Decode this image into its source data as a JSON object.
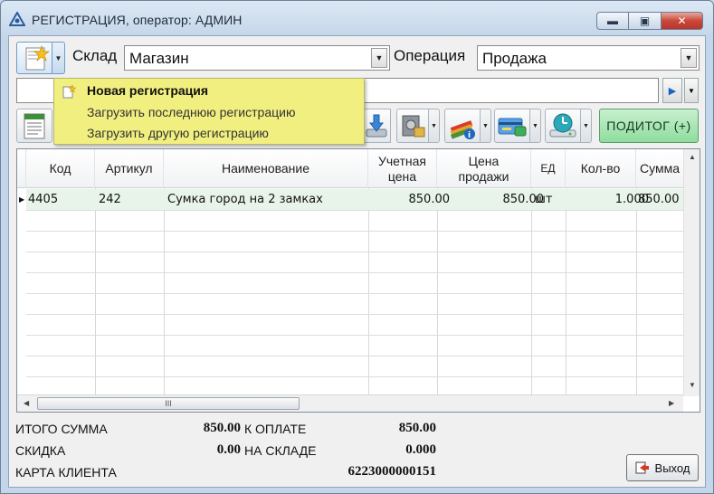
{
  "window": {
    "title": "РЕГИСТРАЦИЯ, оператор: АДМИН",
    "minimize_label": "▬",
    "maximize_label": "▣",
    "close_label": "✕"
  },
  "filters": {
    "warehouse_label": "Склад",
    "warehouse_value": "Магазин",
    "operation_label": "Операция",
    "operation_value": "Продажа"
  },
  "search": {
    "value": "",
    "go_icon": "play-arrow-icon"
  },
  "toolbar": {
    "subtotal_label": "ПОДИТОГ (+)",
    "icons": [
      "calendar-doc-icon",
      "download-tray-icon",
      "safe-money-icon",
      "books-info-icon",
      "card-info-icon",
      "clock-monitor-icon"
    ]
  },
  "grid": {
    "columns": [
      "Код",
      "Артикул",
      "Наименование",
      "Учетная цена",
      "Цена продажи",
      "ЕД",
      "Кол-во",
      "Сумма"
    ],
    "rows": [
      {
        "code": "4405",
        "article": "242",
        "name": "Сумка город на 2 замках",
        "cost_price": "850.00",
        "sale_price": "850.00",
        "unit": "шт",
        "qty": "1.000",
        "sum": "850.00"
      }
    ],
    "hscroll_grip": "III"
  },
  "totals": {
    "total_label": "ИТОГО СУММА",
    "total_value": "850.00",
    "to_pay_label": "К ОПЛАТЕ",
    "to_pay_value": "850.00",
    "discount_label": "СКИДКА",
    "discount_value": "0.00",
    "in_stock_label": "НА СКЛАДЕ",
    "in_stock_value": "0.000",
    "client_card_label": "КАРТА КЛИЕНТА",
    "client_card_value": "6223000000151"
  },
  "exit_label": "Выход",
  "menu": {
    "items": [
      {
        "label": "Новая регистрация",
        "bold": true
      },
      {
        "label": "Загрузить последнюю регистрацию",
        "bold": false
      },
      {
        "label": "Загрузить другую регистрацию",
        "bold": false
      }
    ]
  }
}
